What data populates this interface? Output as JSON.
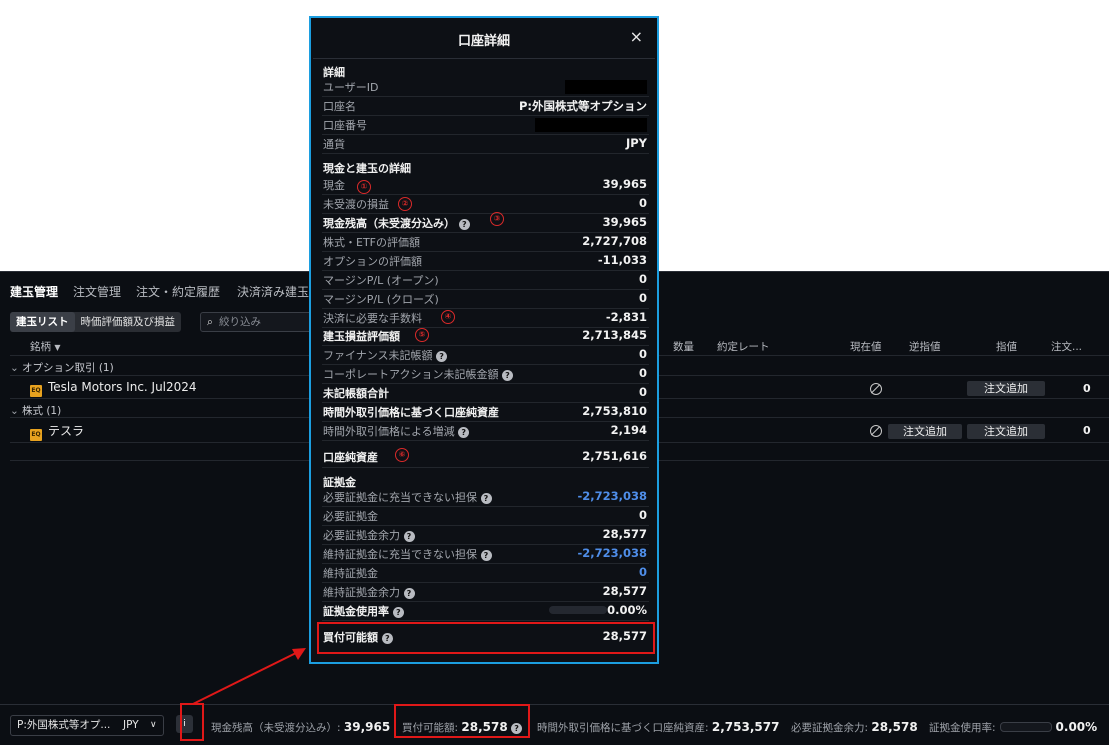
{
  "tabs": [
    "建玉管理",
    "注文管理",
    "注文・約定履歴",
    "決済済み建玉"
  ],
  "subbar": {
    "list_btn": "建玉リスト",
    "mtm_btn": "時価評価額及び損益",
    "search_placeholder": "絞り込み"
  },
  "columns": {
    "symbol": "銘柄",
    "qty": "数量",
    "rate": "約定レート",
    "current": "現在値",
    "stop": "逆指値",
    "limit": "指値",
    "order": "注文..."
  },
  "groups": [
    {
      "label": "オプション取引 (1)",
      "item": {
        "badge": "EQ",
        "name": "Tesla Motors Inc. Jul2024",
        "add_limit": "注文追加",
        "count": "0"
      }
    },
    {
      "label": "株式 (1)",
      "item": {
        "badge": "EQ",
        "name": "テスラ",
        "add_stop": "注文追加",
        "add_limit": "注文追加",
        "count": "0"
      }
    }
  ],
  "status": {
    "account": "P:外国株式等オプ...",
    "currency": "JPY",
    "info_icon": "i",
    "cash_label": "現金残高（未受渡分込み）:",
    "cash_value": "39,965",
    "buying_label": "買付可能額:",
    "buying_value": "28,578",
    "oh_label": "時間外取引価格に基づく口座純資産:",
    "oh_value": "2,753,577",
    "margin_label": "必要証拠金余力:",
    "margin_value": "28,578",
    "usage_label": "証拠金使用率:",
    "usage_value": "0.00%"
  },
  "dialog": {
    "title": "口座詳細",
    "close_icon": "×",
    "sections": {
      "detail": "詳細",
      "cash": "現金と建玉の詳細",
      "margin": "証拠金"
    },
    "rows": {
      "user_id": {
        "label": "ユーザーID",
        "value": ""
      },
      "account_name": {
        "label": "口座名",
        "value": "P:外国株式等オプション"
      },
      "account_no": {
        "label": "口座番号",
        "value": ""
      },
      "currency": {
        "label": "通貨",
        "value": "JPY"
      },
      "cash": {
        "label": "現金",
        "value": "39,965"
      },
      "unsettled_pl": {
        "label": "未受渡の損益",
        "value": "0"
      },
      "cash_balance": {
        "label": "現金残高（未受渡分込み）",
        "value": "39,965"
      },
      "stock_etf": {
        "label": "株式・ETFの評価額",
        "value": "2,727,708"
      },
      "option_value": {
        "label": "オプションの評価額",
        "value": "-11,033"
      },
      "margin_pl_open": {
        "label": "マージンP/L (オープン)",
        "value": "0"
      },
      "margin_pl_close": {
        "label": "マージンP/L (クローズ)",
        "value": "0"
      },
      "settle_fee": {
        "label": "決済に必要な手数料",
        "value": "-2,831"
      },
      "position_pl": {
        "label": "建玉損益評価額",
        "value": "2,713,845"
      },
      "finance_unposted": {
        "label": "ファイナンス未記帳額",
        "value": "0"
      },
      "corp_action_unposted": {
        "label": "コーポレートアクション未記帳金額",
        "value": "0"
      },
      "unposted_total": {
        "label": "未記帳額合計",
        "value": "0"
      },
      "oh_net": {
        "label": "時間外取引価格に基づく口座純資産",
        "value": "2,753,810"
      },
      "oh_change": {
        "label": "時間外取引価格による増減",
        "value": "2,194"
      },
      "net_assets": {
        "label": "口座純資産",
        "value": "2,751,616"
      },
      "req_uncovered": {
        "label": "必要証拠金に充当できない担保",
        "value": "-2,723,038"
      },
      "req_margin": {
        "label": "必要証拠金",
        "value": "0"
      },
      "req_margin_left": {
        "label": "必要証拠金余力",
        "value": "28,577"
      },
      "maint_uncovered": {
        "label": "維持証拠金に充当できない担保",
        "value": "-2,723,038"
      },
      "maint_margin": {
        "label": "維持証拠金",
        "value": "0"
      },
      "maint_margin_left": {
        "label": "維持証拠金余力",
        "value": "28,577"
      },
      "margin_usage": {
        "label": "証拠金使用率",
        "value": "0.00%"
      },
      "buying_power": {
        "label": "買付可能額",
        "value": "28,577"
      }
    },
    "markers": [
      "①",
      "②",
      "③",
      "④",
      "⑤",
      "⑥"
    ]
  },
  "colors": {
    "accent_frame": "#1c9ee0",
    "highlight": "#e01818",
    "negative_blue": "#4f8ee9",
    "badge": "#e8a21f"
  }
}
